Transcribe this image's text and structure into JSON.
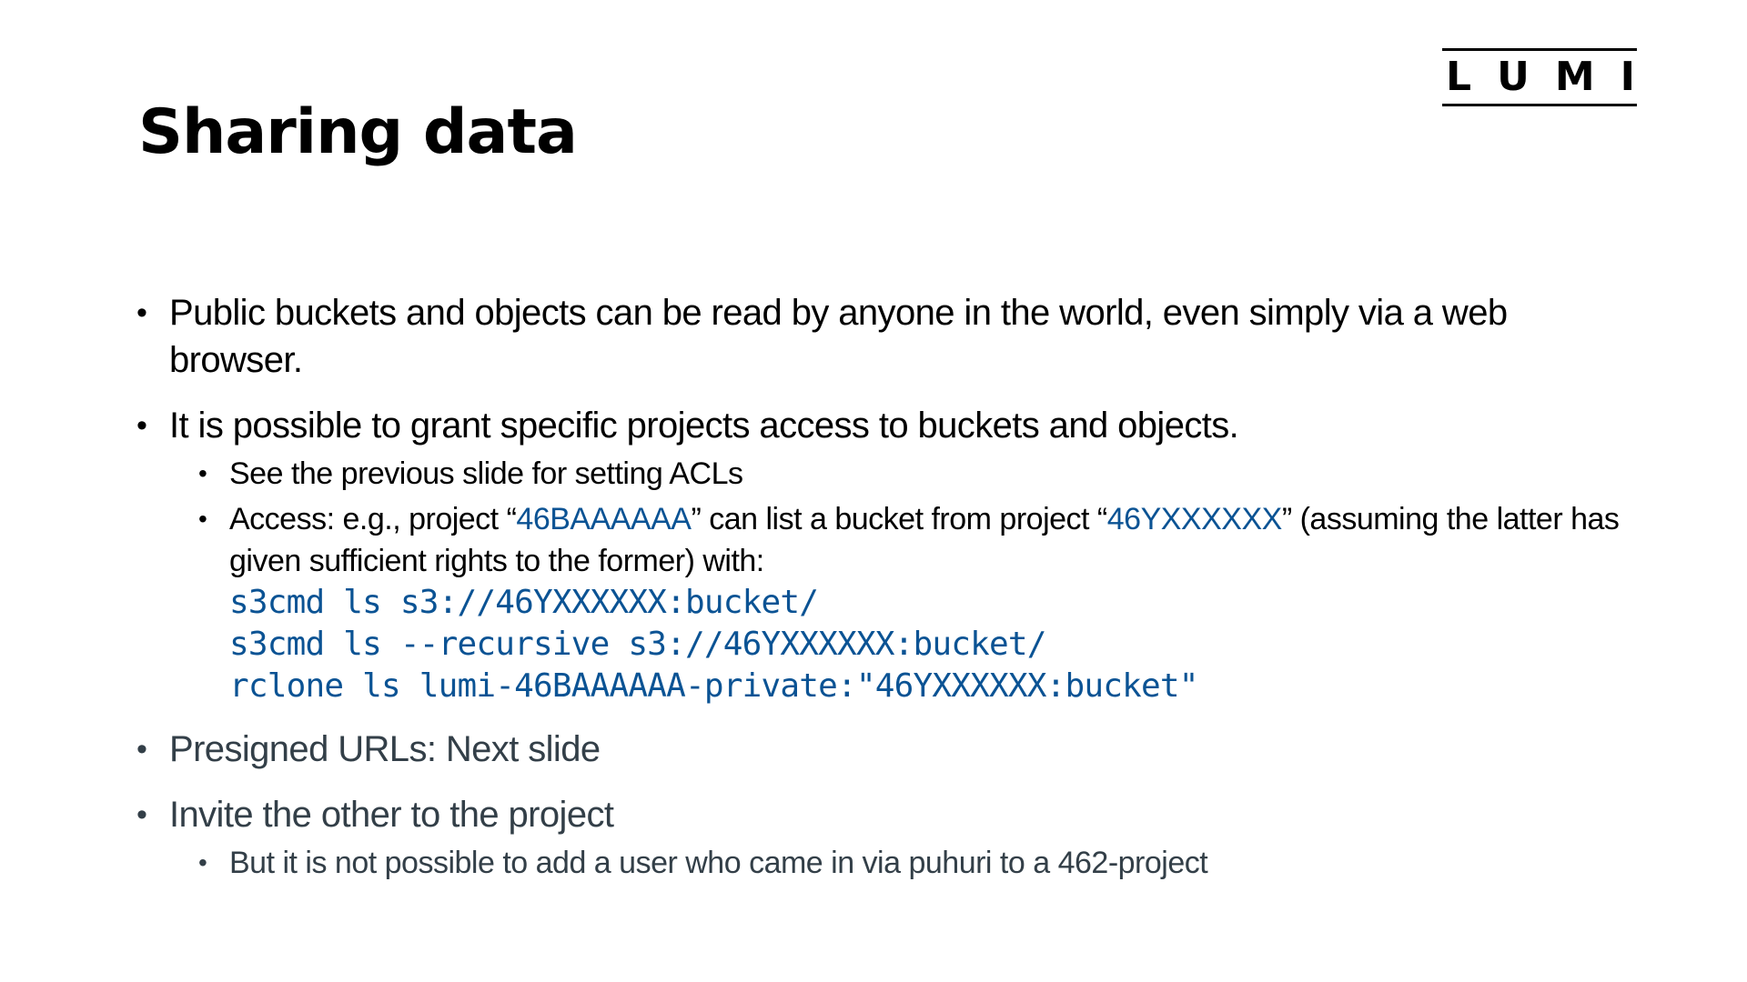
{
  "logo": {
    "letters": [
      "L",
      "U",
      "M",
      "I"
    ]
  },
  "title": "Sharing data",
  "colors": {
    "text": "#000000",
    "muted_text": "#333f48",
    "accent": "#0b5394"
  },
  "bullets": {
    "b1": {
      "text": "Public buckets and objects can be read by anyone in the world, even simply via a web browser."
    },
    "b2": {
      "text": "It is possible to grant specific projects access to buckets and objects.",
      "sub1": "See the previous slide for setting ACLs",
      "sub2": {
        "prefix": "Access:  e.g., project “",
        "project_a": "46BAAAAAA",
        "middle": "” can list a bucket from project “",
        "project_b": "46YXXXXXX",
        "suffix": "” (assuming the latter has given sufficient rights to the former) with:",
        "code_lines": [
          "s3cmd ls s3://46YXXXXXX:bucket/",
          "s3cmd ls --recursive s3://46YXXXXXX:bucket/",
          "rclone ls lumi-46BAAAAAA-private:\"46YXXXXXX:bucket\""
        ]
      }
    },
    "b3": {
      "text": "Presigned URLs: Next slide"
    },
    "b4": {
      "text": "Invite the other to the project",
      "sub1": "But it is not possible to add a user who came in via puhuri to a 462-project"
    }
  }
}
